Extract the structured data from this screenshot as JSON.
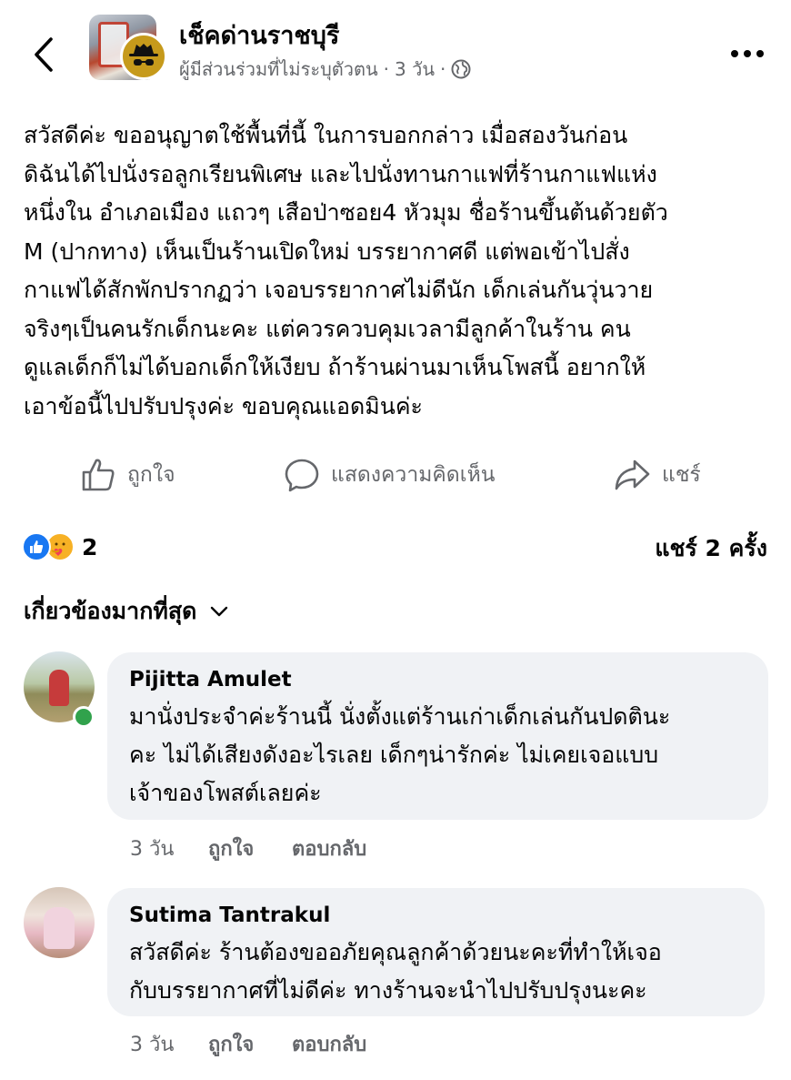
{
  "header": {
    "group_name": "เช็คด่านราชบุรี",
    "author": "ผู้มีส่วนร่วมที่ไม่ระบุตัวตน",
    "separator": "·",
    "time": "3 วัน",
    "privacy_icon": "globe-icon",
    "back_icon": "chevron-left-icon",
    "more_icon": "more-horizontal-icon"
  },
  "post": {
    "text": "สวัสดีค่ะ ขออนุญาตใช้พื้นที่นี้ ในการบอกกล่าว เมื่อสองวันก่อน\nดิฉันได้ไปนั่งรอลูกเรียนพิเศษ และไปนั่งทานกาแฟที่ร้านกาแฟแห่ง\nหนึ่งใน อำเภอเมือง แถวๆ เสือป่าซอย4 หัวมุม ชื่อร้านขึ้นต้นด้วยตัว\nM (ปากทาง) เห็นเป็นร้านเปิดใหม่ บรรยากาศดี แต่พอเข้าไปสั่ง\nกาแฟได้สักพักปรากฏว่า เจอบรรยากาศไม่ดีนัก เด็กเล่นกันวุ่นวาย\nจริงๆเป็นคนรักเด็กนะคะ แต่ควรควบคุมเวลามีลูกค้าในร้าน คน\nดูแลเด็กก็ไม่ได้บอกเด็กให้เงียบ ถ้าร้านผ่านมาเห็นโพสนี้ อยากให้\nเอาข้อนี้ไปปรับปรุงค่ะ ขอบคุณแอดมินค่ะ"
  },
  "actions": {
    "like_label": "ถูกใจ",
    "comment_label": "แสดงความคิดเห็น",
    "share_label": "แชร์"
  },
  "stats": {
    "reaction_count": "2",
    "reaction_icons": [
      "like-reaction-icon",
      "care-reaction-icon"
    ],
    "share_count": "แชร์ 2 ครั้ง"
  },
  "sort": {
    "label": "เกี่ยวข้องมากที่สุด"
  },
  "comments": [
    {
      "author": "Pijitta Amulet",
      "text": "มานั่งประจำค่ะร้านนี้ นั่งตั้งแต่ร้านเก่าเด็กเล่นกันปดตินะ\nคะ ไม่ได้เสียงดังอะไรเลย เด็กๆน่ารักค่ะ ไม่เคยเจอแบบ\nเจ้าของโพสต์เลยค่ะ",
      "time": "3 วัน",
      "like_label": "ถูกใจ",
      "reply_label": "ตอบกลับ"
    },
    {
      "author": "Sutima Tantrakul",
      "text": "สวัสดีค่ะ ร้านต้องขออภัยคุณลูกค้าด้วยนะคะที่ทำให้เจอ\nกับบรรยากาศที่ไม่ดีค่ะ ทางร้านจะนำไปปรับปรุงนะคะ",
      "time": "3 วัน",
      "like_label": "ถูกใจ",
      "reply_label": "ตอบกลับ"
    }
  ],
  "colors": {
    "text_primary": "#050505",
    "text_secondary": "#65676b",
    "bubble_bg": "#f0f2f5",
    "like_blue": "#1877f2",
    "online_green": "#31a24c",
    "anon_gold": "#c69a1b"
  }
}
